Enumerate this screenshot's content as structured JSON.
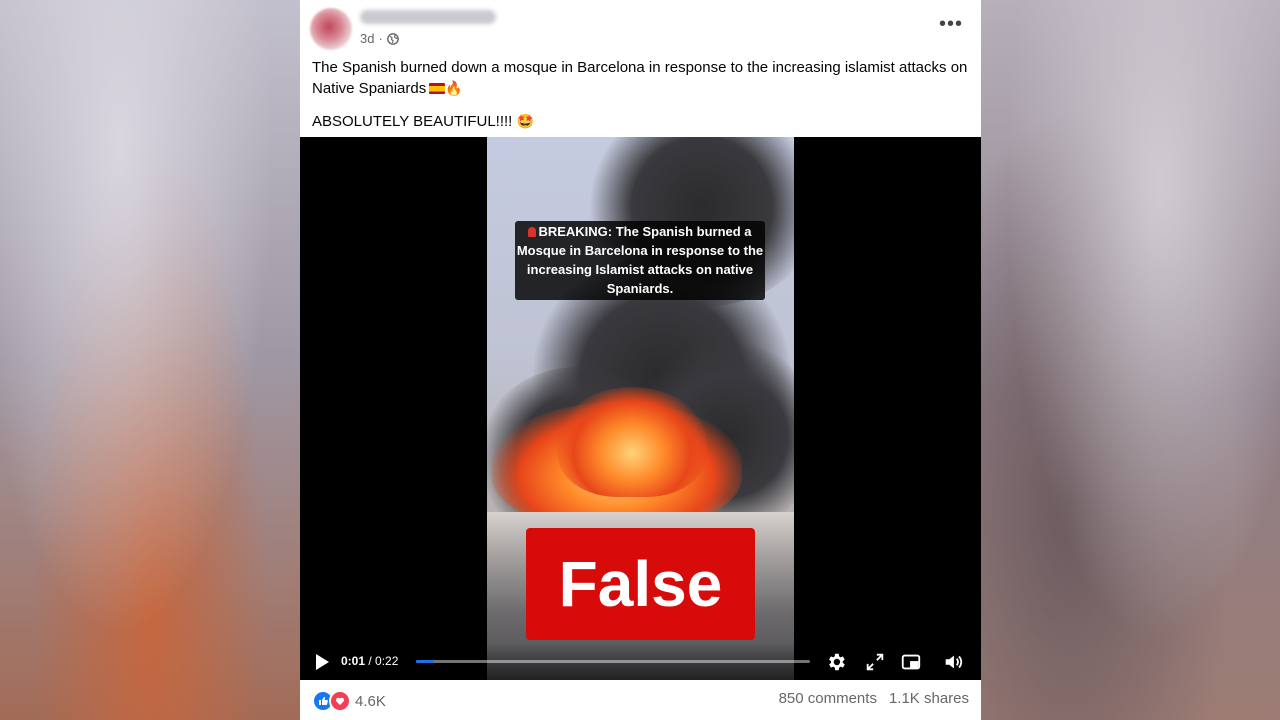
{
  "post": {
    "time": "3d",
    "privacy_icon": "globe-icon",
    "more_icon": "more-options-icon",
    "caption_line1": "The Spanish burned down a mosque in Barcelona in response to the increasing islamist attacks on Native Spaniards",
    "caption_emoji1": "🔥",
    "caption_line2": "ABSOLUTELY BEAUTIFUL!!!!",
    "caption_emoji2": "🤩"
  },
  "video": {
    "overlay_text": "BREAKING: The Spanish burned a Mosque in Barcelona in response to the increasing Islamist attacks on native Spaniards.",
    "verdict": "False",
    "current_time": "0:01",
    "duration": "/ 0:22",
    "progress_fraction": 0.045
  },
  "footer": {
    "reaction_count": "4.6K",
    "comments": "850 comments",
    "shares": "1.1K shares"
  },
  "colors": {
    "verdict_bg": "#d80b0b",
    "progress": "#1b74e4",
    "like": "#1877f2",
    "love": "#f33e58"
  }
}
